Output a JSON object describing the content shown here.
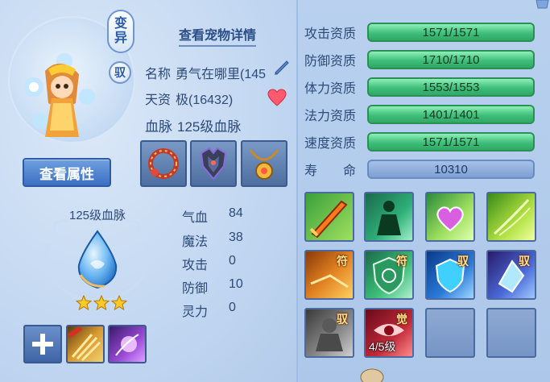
{
  "header": {
    "detail_link": "查看宠物详情"
  },
  "badges": {
    "variant_line1": "变",
    "variant_line2": "异",
    "yu": "驭"
  },
  "pet": {
    "name_label": "名称",
    "name_value": "勇气在哪里(145",
    "talent_label": "天资",
    "talent_value": "极(16432)",
    "blood_label": "血脉",
    "blood_value": "125级血脉"
  },
  "buttons": {
    "view_attributes": "查看属性"
  },
  "equipment": {
    "icons": [
      "necklace-icon",
      "armor-icon",
      "amulet-icon"
    ]
  },
  "bloodline": {
    "label": "125级血脉",
    "stars": 3
  },
  "stats": [
    {
      "label": "气血",
      "value": "84"
    },
    {
      "label": "魔法",
      "value": "38"
    },
    {
      "label": "攻击",
      "value": "0"
    },
    {
      "label": "防御",
      "value": "10"
    },
    {
      "label": "灵力",
      "value": "0"
    }
  ],
  "attributes": [
    {
      "label": "攻击资质",
      "value": "1571/1571"
    },
    {
      "label": "防御资质",
      "value": "1710/1710"
    },
    {
      "label": "体力资质",
      "value": "1553/1553"
    },
    {
      "label": "法力资质",
      "value": "1401/1401"
    },
    {
      "label": "速度资质",
      "value": "1571/1571"
    },
    {
      "label": "寿　　命",
      "value": "10310"
    }
  ],
  "skill_tags": {
    "fu1": "符",
    "fu2": "符",
    "yu1": "驭",
    "yu2": "驭",
    "yu3": "驭",
    "jue": "觉",
    "level": "4/5级"
  },
  "small_skills": {
    "tag": "驭"
  },
  "colors": {
    "bar_green": "#3fbf7a",
    "bar_blue": "#7e9fd2",
    "button_blue": "#3b6fc2",
    "accent_text": "#2d4a78"
  }
}
